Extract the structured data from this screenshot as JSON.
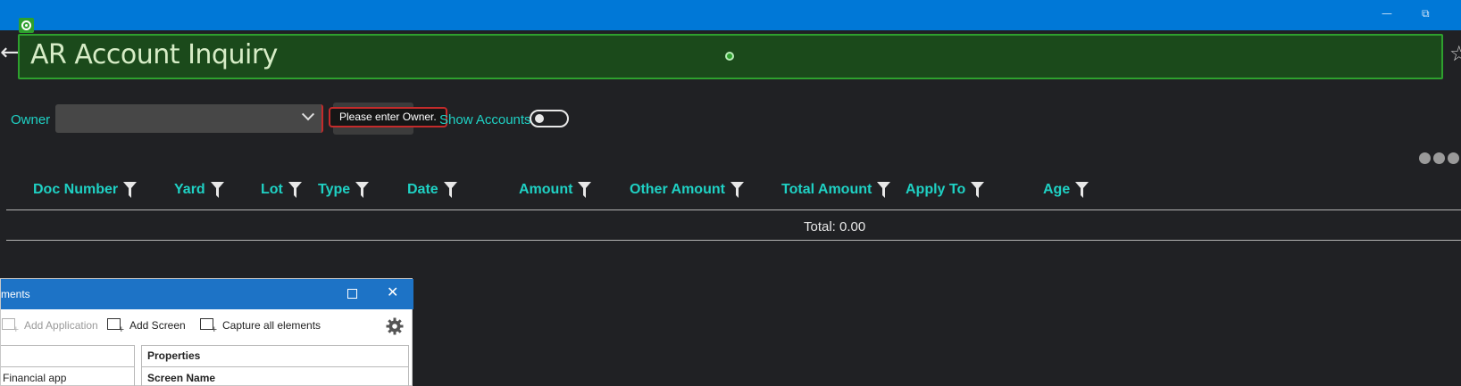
{
  "window": {
    "minimize_glyph": "—",
    "restore_glyph": "⧉"
  },
  "header": {
    "title": "AR Account Inquiry",
    "back_glyph": "←",
    "favorite_glyph": "☆",
    "highlight_color": "#2ea02e"
  },
  "filters": {
    "owner_label": "Owner",
    "owner_value": "",
    "validation_message": "Please enter Owner.",
    "show_accounts_label": "Show Accounts",
    "show_accounts_on": false
  },
  "grid": {
    "columns": [
      {
        "label": "Doc Number"
      },
      {
        "label": "Yard"
      },
      {
        "label": "Lot"
      },
      {
        "label": "Type"
      },
      {
        "label": "Date"
      },
      {
        "label": "Amount"
      },
      {
        "label": "Other Amount"
      },
      {
        "label": "Total Amount"
      },
      {
        "label": "Apply To"
      },
      {
        "label": "Age"
      }
    ],
    "total": "Total: 0.00"
  },
  "dialog": {
    "title": "ments",
    "close_glyph": "✕",
    "toolbar": {
      "add_application": "Add Application",
      "add_screen": "Add Screen",
      "capture_all": "Capture all elements"
    },
    "tree_item": "Financial app",
    "properties_header": "Properties",
    "screen_name_label": "Screen Name"
  },
  "colors": {
    "accent": "#1fd1c4",
    "titlebar": "#0078d7",
    "error": "#c42b2b",
    "background": "#202124"
  }
}
